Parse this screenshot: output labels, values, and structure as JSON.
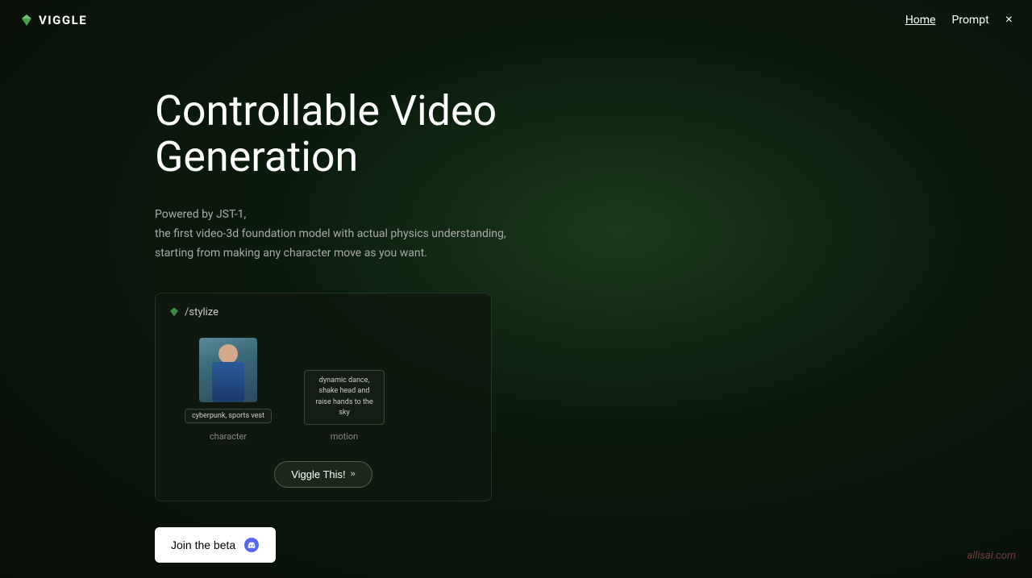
{
  "header": {
    "logo_text": "VIGGLE",
    "nav_home": "Home",
    "nav_prompt": "Prompt",
    "close_label": "×"
  },
  "hero": {
    "title": "Controllable Video Generation",
    "subtitle_line1": "Powered by JST-1,",
    "subtitle_line2": "the first video-3d foundation model with actual physics understanding,",
    "subtitle_line3": "starting from making any character move as you want."
  },
  "demo_card": {
    "command": "/stylize",
    "character_tag": "cyberpunk, sports vest",
    "character_label": "character",
    "motion_tag_line1": "dynamic dance, shake head and",
    "motion_tag_line2": "raise hands to the sky",
    "motion_label": "motion",
    "viggle_btn_label": "Viggle This!",
    "viggle_btn_arrow": "»"
  },
  "cta": {
    "join_beta_label": "Join the beta"
  },
  "watermark": {
    "text": "allisai.com"
  }
}
